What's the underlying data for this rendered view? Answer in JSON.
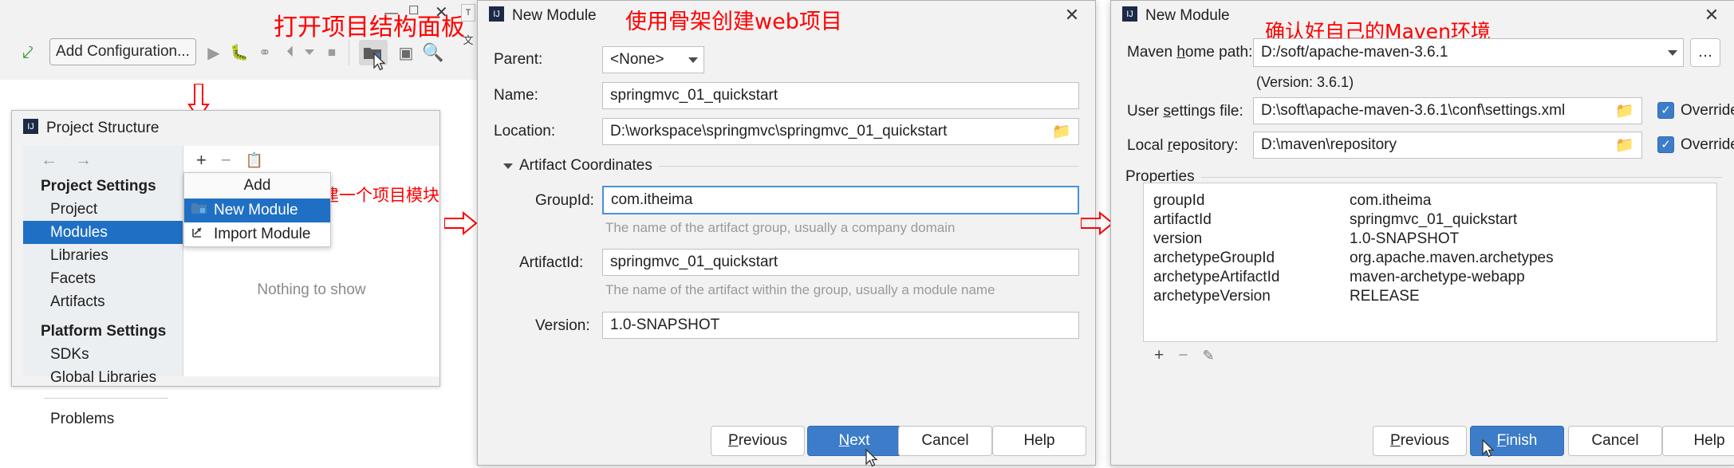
{
  "annotations": {
    "toolbar_note": "打开项目结构面板",
    "module_note": "新建一个项目模块",
    "skeleton_note": "使用骨架创建web项目",
    "maven_note": "确认好自己的Maven环境"
  },
  "ide_toolbar": {
    "add_configuration": "Add Configuration...",
    "icons": [
      "hammer-build-icon",
      "run-icon",
      "debug-icon",
      "run-coverage-icon",
      "profile-icon",
      "dropdown-icon",
      "stop-icon",
      "project-structure-icon",
      "terminal-icon",
      "search-everywhere-icon"
    ],
    "window_buttons": [
      "minimize-icon",
      "maximize-icon",
      "close-icon"
    ],
    "side_tabs": [
      "T",
      "文"
    ]
  },
  "project_structure": {
    "title": "Project Structure",
    "nav_back": "←",
    "nav_forward": "→",
    "sections": [
      {
        "header": "Project Settings",
        "items": [
          "Project",
          "Modules",
          "Libraries",
          "Facets",
          "Artifacts"
        ]
      },
      {
        "header": "Platform Settings",
        "items": [
          "SDKs",
          "Global Libraries"
        ]
      }
    ],
    "selected_item": "Modules",
    "problems_label": "Problems",
    "toolbar_icons": [
      "add-icon",
      "remove-icon",
      "copy-icon"
    ],
    "empty_text": "Nothing to show",
    "add_menu": {
      "header": "Add",
      "items": [
        {
          "label": "New Module",
          "icon": "new-module-icon",
          "selected": true
        },
        {
          "label": "Import Module",
          "icon": "import-module-icon",
          "selected": false
        }
      ]
    }
  },
  "new_module_dialog": {
    "title": "New Module",
    "close_label": "✕",
    "fields": {
      "parent_label": "Parent:",
      "parent_value": "<None>",
      "name_label": "Name:",
      "name_value": "springmvc_01_quickstart",
      "location_label": "Location:",
      "location_value": "D:\\workspace\\springmvc\\springmvc_01_quickstart",
      "artifact_group_header": "Artifact Coordinates",
      "groupid_label": "GroupId:",
      "groupid_value": "com.itheima",
      "groupid_hint": "The name of the artifact group, usually a company domain",
      "artifactid_label": "ArtifactId:",
      "artifactid_value": "springmvc_01_quickstart",
      "artifactid_hint": "The name of the artifact within the group, usually a module name",
      "version_label": "Version:",
      "version_value": "1.0-SNAPSHOT"
    },
    "buttons": [
      {
        "label": "Previous",
        "mnemonic": "P",
        "primary": false
      },
      {
        "label": "Next",
        "mnemonic": "N",
        "primary": true
      },
      {
        "label": "Cancel",
        "mnemonic": "",
        "primary": false
      },
      {
        "label": "Help",
        "mnemonic": "",
        "primary": false
      }
    ]
  },
  "maven_dialog": {
    "title": "New Module",
    "close_label": "✕",
    "maven_home_label_pre": "Maven ",
    "maven_home_label_mn": "h",
    "maven_home_label_post": "ome path:",
    "maven_home_value": "D:/soft/apache-maven-3.6.1",
    "version_note": "(Version: 3.6.1)",
    "user_settings_label_pre": "User ",
    "user_settings_label_mn": "s",
    "user_settings_label_post": "ettings file:",
    "user_settings_value": "D:\\soft\\apache-maven-3.6.1\\conf\\settings.xml",
    "user_settings_override": "Override",
    "local_repo_label_pre": "Local ",
    "local_repo_label_mn": "r",
    "local_repo_label_post": "epository:",
    "local_repo_value": "D:\\maven\\repository",
    "local_repo_override": "Override",
    "properties_header": "Properties",
    "properties": [
      {
        "key": "groupId",
        "value": "com.itheima"
      },
      {
        "key": "artifactId",
        "value": "springmvc_01_quickstart"
      },
      {
        "key": "version",
        "value": "1.0-SNAPSHOT"
      },
      {
        "key": "archetypeGroupId",
        "value": "org.apache.maven.archetypes"
      },
      {
        "key": "archetypeArtifactId",
        "value": "maven-archetype-webapp"
      },
      {
        "key": "archetypeVersion",
        "value": "RELEASE"
      }
    ],
    "prop_toolbar_icons": [
      "add-property-icon",
      "remove-property-icon",
      "edit-property-icon"
    ],
    "buttons": [
      {
        "label": "Previous",
        "mnemonic": "P",
        "primary": false
      },
      {
        "label": "Finish",
        "mnemonic": "F",
        "primary": true
      },
      {
        "label": "Cancel",
        "mnemonic": "",
        "primary": false
      },
      {
        "label": "Help",
        "mnemonic": "",
        "primary": false
      }
    ]
  },
  "colors": {
    "accent": "#1f6fc4",
    "primary_button": "#3d7cc9",
    "annotation_red": "#ff0000",
    "dialog_bg": "#f2f2f2"
  }
}
